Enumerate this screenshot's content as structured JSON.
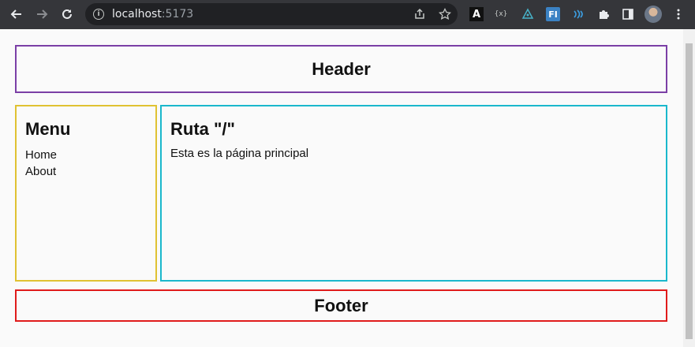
{
  "browser": {
    "url_host": "localhost",
    "url_port": ":5173",
    "extensions": [
      "A",
      "{x}",
      "vue-devtools-icon",
      "FI",
      "wind-icon",
      "puzzle-icon"
    ]
  },
  "page": {
    "header": "Header",
    "menu_title": "Menu",
    "menu_links": [
      "Home",
      "About"
    ],
    "route_title": "Ruta \"/\"",
    "route_text": "Esta es la página principal",
    "footer": "Footer"
  },
  "colors": {
    "header_border": "#7b3fa6",
    "menu_border": "#e0c232",
    "main_border": "#1ab8cc",
    "footer_border": "#e01b1b"
  }
}
